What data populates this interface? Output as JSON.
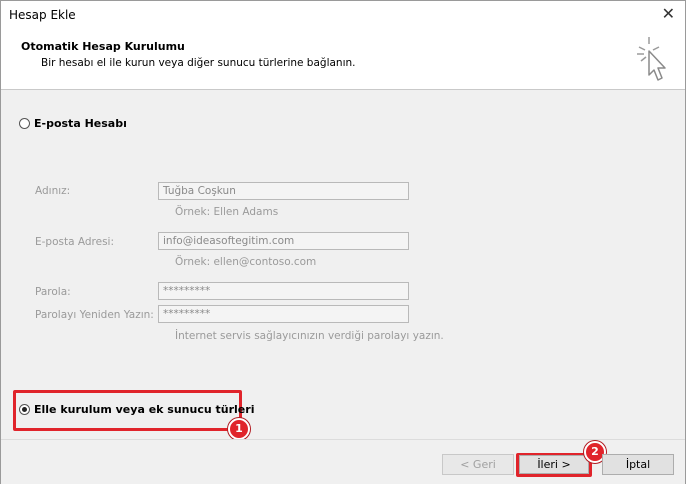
{
  "window": {
    "title": "Hesap Ekle",
    "close_glyph": "✕"
  },
  "header": {
    "title": "Otomatik Hesap Kurulumu",
    "subtitle": "Bir hesabı el ile kurun veya diğer sunucu türlerine bağlanın.",
    "icon": "wizard-cursor-icon"
  },
  "options": {
    "email_account": {
      "label": "E-posta Hesabı",
      "selected": false
    },
    "manual_setup": {
      "label": "Elle kurulum veya ek sunucu türleri",
      "selected": true
    }
  },
  "form": {
    "name": {
      "label": "Adınız:",
      "value": "Tuğba Coşkun",
      "hint": "Örnek: Ellen Adams"
    },
    "email": {
      "label": "E-posta Adresi:",
      "value": "info@ideasoftegitim.com",
      "hint": "Örnek: ellen@contoso.com"
    },
    "password": {
      "label": "Parola:",
      "value": "*********"
    },
    "password_confirm": {
      "label": "Parolayı Yeniden Yazın:",
      "value": "*********"
    },
    "password_hint": "İnternet servis sağlayıcınızın verdiği parolayı yazın."
  },
  "annotations": {
    "step1": "1",
    "step2": "2",
    "accent": "#e0242b"
  },
  "buttons": {
    "back": "< Geri",
    "next": "İleri >",
    "cancel": "İptal"
  }
}
